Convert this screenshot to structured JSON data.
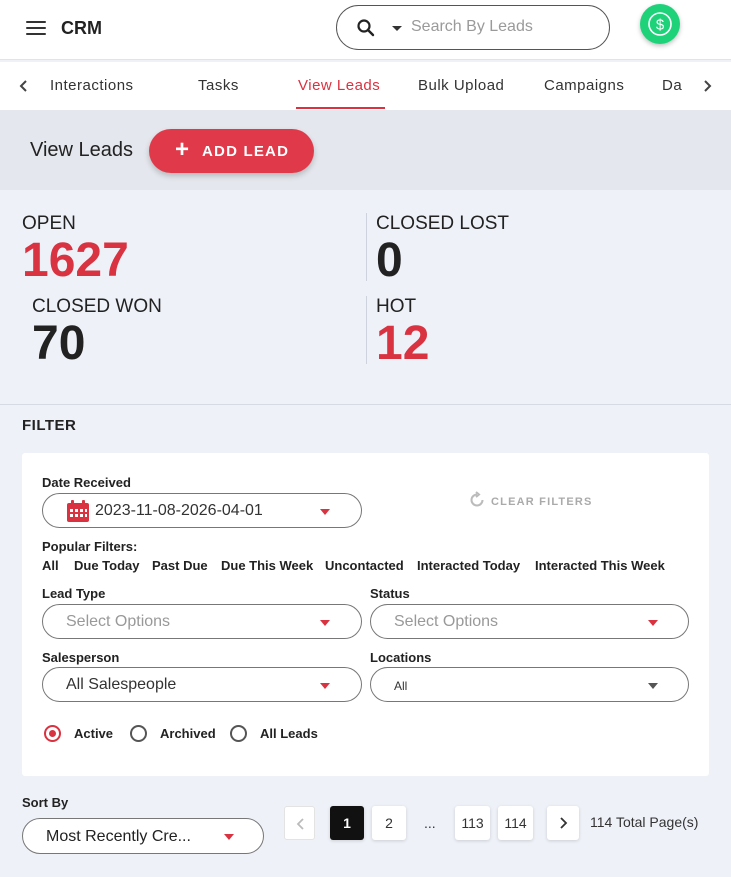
{
  "header": {
    "app_title": "CRM",
    "search_placeholder": "Search By Leads",
    "icons": {
      "menu": "hamburger-menu-icon",
      "search": "search-icon",
      "dollar": "dollar-circle-icon"
    },
    "dollar_color": "#1ed27a"
  },
  "tabs": {
    "items": [
      {
        "label": "Interactions",
        "active": false
      },
      {
        "label": "Tasks",
        "active": false
      },
      {
        "label": "View Leads",
        "active": true
      },
      {
        "label": "Bulk Upload",
        "active": false
      },
      {
        "label": "Campaigns",
        "active": false
      },
      {
        "label": "Da",
        "active": false
      }
    ],
    "active_color": "#d93240"
  },
  "page": {
    "title": "View Leads",
    "add_lead_label": "ADD LEAD",
    "accent_color": "#e03a4a"
  },
  "stats": {
    "open": {
      "label": "OPEN",
      "value": "1627"
    },
    "closed_lost": {
      "label": "CLOSED LOST",
      "value": "0"
    },
    "closed_won": {
      "label": "CLOSED WON",
      "value": "70"
    },
    "hot": {
      "label": "HOT",
      "value": "12"
    }
  },
  "filter": {
    "heading": "FILTER",
    "date_received_label": "Date Received",
    "date_range": "2023-11-08-2026-04-01",
    "clear_filters": "CLEAR FILTERS",
    "popular_title": "Popular Filters:",
    "popular": [
      "All",
      "Due Today",
      "Past Due",
      "Due This Week",
      "Uncontacted",
      "Interacted Today",
      "Interacted This Week"
    ],
    "lead_type_label": "Lead Type",
    "lead_type_placeholder": "Select Options",
    "status_label": "Status",
    "status_placeholder": "Select Options",
    "salesperson_label": "Salesperson",
    "salesperson_value": "All Salespeople",
    "locations_label": "Locations",
    "locations_value": "All",
    "radios": [
      {
        "label": "Active",
        "checked": true
      },
      {
        "label": "Archived",
        "checked": false
      },
      {
        "label": "All Leads",
        "checked": false
      }
    ]
  },
  "sort": {
    "label": "Sort By",
    "value": "Most Recently Cre..."
  },
  "pagination": {
    "pages": [
      "1",
      "2",
      "113",
      "114"
    ],
    "current": "1",
    "ellipsis": "...",
    "total": "114 Total Page(s)"
  }
}
